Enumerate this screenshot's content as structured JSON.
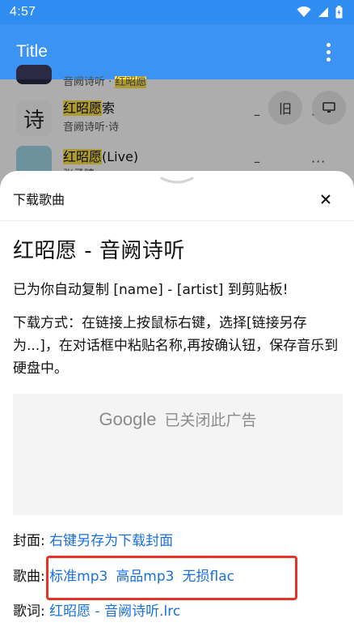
{
  "status_bar": {
    "time": "4:57",
    "icons": [
      "wifi-icon",
      "signal-icon",
      "battery-charging-icon"
    ]
  },
  "app_bar": {
    "title": "Title",
    "menu_icon": "more-vert-icon"
  },
  "background_list": {
    "rows": [
      {
        "line1": "音阙诗听",
        "line1_highlight": "红昭愿"
      },
      {
        "title_highlight": "红昭愿",
        "title_rest": "索",
        "subtitle": "音阙诗听·诗",
        "thumb_char": "诗",
        "dash": "–",
        "more": "···",
        "button": "旧"
      },
      {
        "title_highlight": "红昭愿",
        "title_rest": "(Live)",
        "subtitle": "张子晴",
        "dash": "–",
        "more": "···"
      }
    ]
  },
  "sheet": {
    "title": "下载歌曲",
    "close_icon": "close-icon",
    "song_title": "红昭愿 - 音阙诗听",
    "copied_notice": "已为你自动复制 [name] - [artist] 到剪贴板!",
    "instructions": "下载方式：在链接上按鼠标右键，选择[链接另存为...]，在对话框中粘贴名称,再按确认钮，保存音乐到硬盘中。",
    "ad": {
      "brand": "Google",
      "message": "已关闭此广告"
    },
    "cover": {
      "label": "封面:",
      "link": "右键另存为下载封面"
    },
    "song": {
      "label": "歌曲:",
      "links": [
        "标准mp3",
        "高品mp3",
        "无损flac"
      ]
    },
    "lyrics": {
      "label": "歌词:",
      "link": "红昭愿 - 音阙诗听.lrc"
    }
  },
  "colors": {
    "status_bar": "#2f8cf0",
    "app_bar": "#3b93f3",
    "link": "#1a6fe0",
    "highlight": "#ffe34a",
    "annotation_box": "#e53328"
  }
}
